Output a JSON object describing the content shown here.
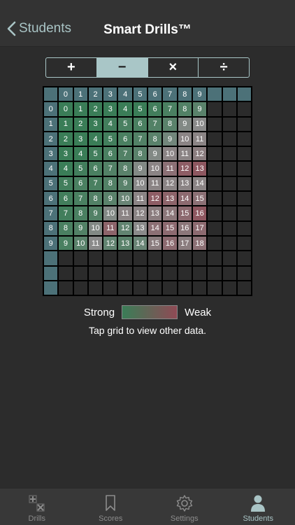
{
  "nav": {
    "back_label": "Students",
    "title": "Smart Drills™"
  },
  "operations": [
    {
      "label": "+",
      "active": false
    },
    {
      "label": "−",
      "active": true
    },
    {
      "label": "×",
      "active": false
    },
    {
      "label": "÷",
      "active": false
    }
  ],
  "grid": {
    "column_headers": [
      "0",
      "1",
      "2",
      "3",
      "4",
      "5",
      "6",
      "7",
      "8",
      "9",
      "",
      "",
      ""
    ],
    "row_headers": [
      "0",
      "1",
      "2",
      "3",
      "4",
      "5",
      "6",
      "7",
      "8",
      "9",
      "",
      "",
      ""
    ],
    "total_rows": 13,
    "total_cols": 13,
    "cells": [
      [
        "0",
        "1",
        "2",
        "3",
        "4",
        "5",
        "6",
        "7",
        "8",
        "9"
      ],
      [
        "1",
        "2",
        "3",
        "4",
        "5",
        "6",
        "7",
        "8",
        "9",
        "10"
      ],
      [
        "2",
        "3",
        "4",
        "5",
        "6",
        "7",
        "8",
        "9",
        "10",
        "11"
      ],
      [
        "3",
        "4",
        "5",
        "6",
        "7",
        "8",
        "9",
        "10",
        "11",
        "12"
      ],
      [
        "4",
        "5",
        "6",
        "7",
        "8",
        "9",
        "10",
        "11",
        "12",
        "13"
      ],
      [
        "5",
        "6",
        "7",
        "8",
        "9",
        "10",
        "11",
        "12",
        "13",
        "14"
      ],
      [
        "6",
        "7",
        "8",
        "9",
        "10",
        "11",
        "12",
        "13",
        "14",
        "15"
      ],
      [
        "7",
        "8",
        "9",
        "10",
        "11",
        "12",
        "13",
        "14",
        "15",
        "16"
      ],
      [
        "8",
        "9",
        "10",
        "11",
        "12",
        "13",
        "14",
        "15",
        "16",
        "17"
      ],
      [
        "9",
        "10",
        "11",
        "12",
        "13",
        "14",
        "15",
        "16",
        "17",
        "18"
      ]
    ],
    "strength": [
      [
        0,
        0,
        0,
        0,
        0,
        0,
        0.05,
        0.1,
        0.15,
        0.2
      ],
      [
        0,
        0,
        0,
        0.05,
        0.1,
        0.1,
        0.15,
        0.2,
        0.45,
        0.5
      ],
      [
        0,
        0,
        0,
        0.05,
        0.1,
        0.15,
        0.2,
        0.35,
        0.55,
        0.55
      ],
      [
        0,
        0,
        0.05,
        0.1,
        0.15,
        0.2,
        0.45,
        0.55,
        0.55,
        0.6
      ],
      [
        0,
        0.05,
        0.1,
        0.15,
        0.2,
        0.45,
        0.55,
        0.7,
        0.85,
        0.9
      ],
      [
        0.05,
        0.1,
        0.1,
        0.15,
        0.2,
        0.5,
        0.55,
        0.55,
        0.55,
        0.55
      ],
      [
        0.05,
        0.1,
        0.15,
        0.2,
        0.3,
        0.55,
        0.85,
        0.8,
        0.75,
        0.7
      ],
      [
        0.05,
        0.1,
        0.15,
        0.45,
        0.55,
        0.55,
        0.6,
        0.65,
        0.75,
        0.9
      ],
      [
        0.1,
        0.15,
        0.45,
        0.8,
        0.25,
        0.5,
        0.7,
        0.75,
        0.65,
        0.75
      ],
      [
        0.1,
        0.2,
        0.5,
        0.25,
        0.2,
        0.3,
        0.6,
        0.75,
        0.6,
        0.7
      ]
    ],
    "colors": {
      "strong": "#3a7d57",
      "weak": "#8f4a55",
      "neutral": "#8a8a8a",
      "header": "#4c7178",
      "empty": "#2b2b2b"
    }
  },
  "legend": {
    "strong_label": "Strong",
    "weak_label": "Weak"
  },
  "hint": "Tap grid to view other data.",
  "tabs": [
    {
      "label": "Drills",
      "icon": "drills-icon",
      "active": false
    },
    {
      "label": "Scores",
      "icon": "bookmark-icon",
      "active": false
    },
    {
      "label": "Settings",
      "icon": "gear-icon",
      "active": false
    },
    {
      "label": "Students",
      "icon": "person-icon",
      "active": true
    }
  ]
}
